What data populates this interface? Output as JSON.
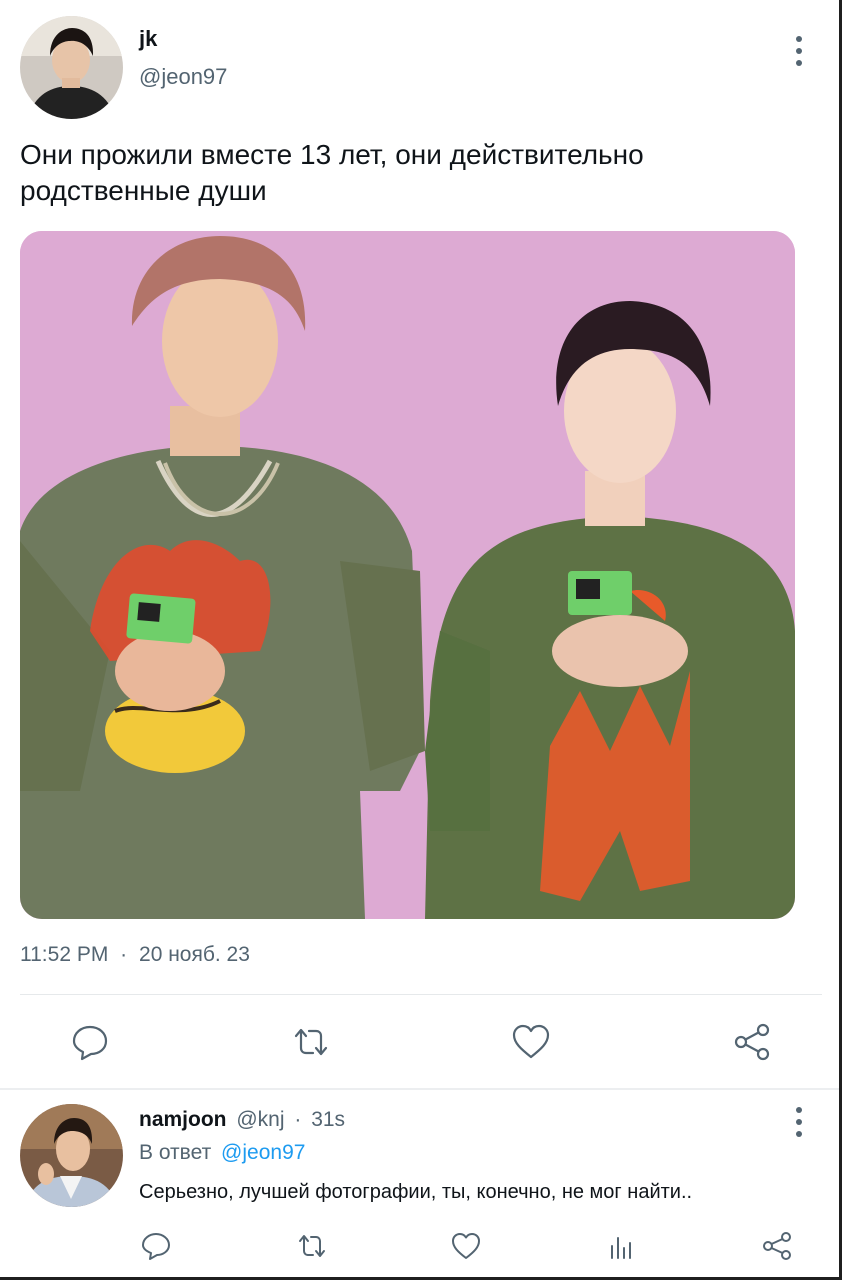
{
  "tweet": {
    "display_name": "jk",
    "handle": "@jeon97",
    "text": "Они прожили вместе 13 лет, они действительно родственные души",
    "time": "11:52 PM",
    "date_separator": "·",
    "date": "20 нояб. 23",
    "actions": {
      "reply_icon": "reply-icon",
      "retweet_icon": "retweet-icon",
      "like_icon": "heart-icon",
      "share_icon": "share-icon"
    }
  },
  "reply": {
    "display_name": "namjoon",
    "handle": "@knj",
    "separator": "·",
    "age": "31s",
    "in_reply_to_label": "В ответ",
    "in_reply_to_handle": "@jeon97",
    "text": "Серьезно, лучшей фотографии, ты, конечно, не мог найти..",
    "actions": [
      "reply-icon",
      "retweet-icon",
      "heart-icon",
      "analytics-icon",
      "share-icon"
    ]
  },
  "colors": {
    "text_primary": "#0f1419",
    "text_secondary": "#536471",
    "link": "#1d9bf0",
    "media_background": "#ddaad3"
  }
}
